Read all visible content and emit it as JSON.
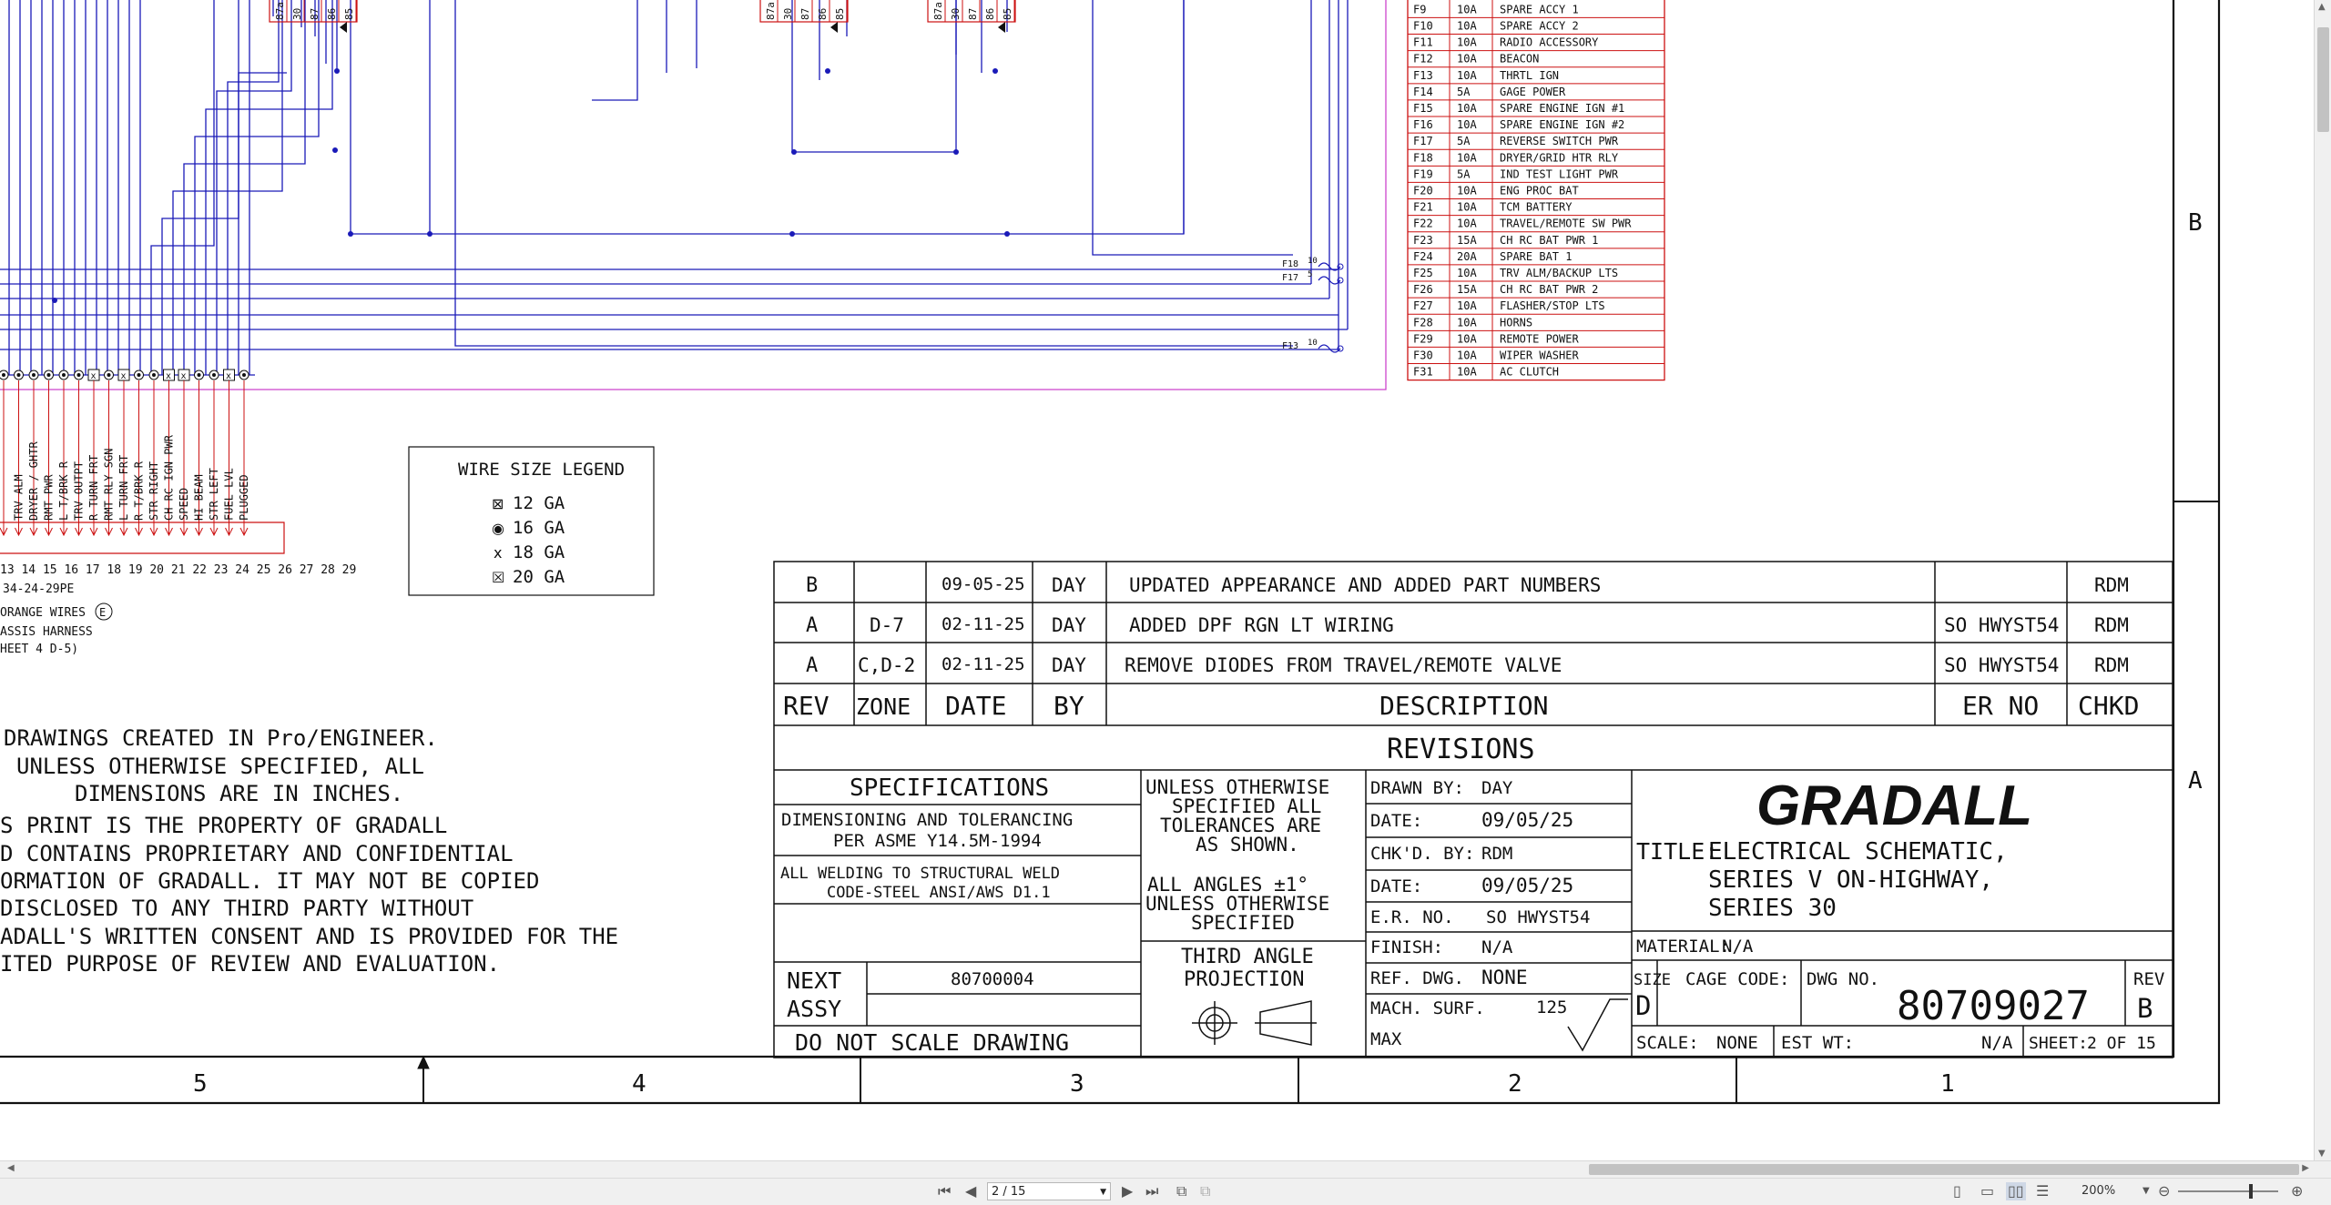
{
  "drawing": {
    "fuse_table": [
      [
        "F9",
        "10A",
        "SPARE ACCY 1"
      ],
      [
        "F10",
        "10A",
        "SPARE ACCY 2"
      ],
      [
        "F11",
        "10A",
        "RADIO ACCESSORY"
      ],
      [
        "F12",
        "10A",
        "BEACON"
      ],
      [
        "F13",
        "10A",
        "THRTL IGN"
      ],
      [
        "F14",
        "5A",
        "GAGE POWER"
      ],
      [
        "F15",
        "10A",
        "SPARE ENGINE IGN #1"
      ],
      [
        "F16",
        "10A",
        "SPARE ENGINE IGN #2"
      ],
      [
        "F17",
        "5A",
        "REVERSE SWITCH PWR"
      ],
      [
        "F18",
        "10A",
        "DRYER/GRID HTR RLY"
      ],
      [
        "F19",
        "5A",
        "IND TEST LIGHT PWR"
      ],
      [
        "F20",
        "10A",
        "ENG PROC BAT"
      ],
      [
        "F21",
        "10A",
        "TCM BATTERY"
      ],
      [
        "F22",
        "10A",
        "TRAVEL/REMOTE SW PWR"
      ],
      [
        "F23",
        "15A",
        "CH RC BAT PWR 1"
      ],
      [
        "F24",
        "20A",
        "SPARE BAT 1"
      ],
      [
        "F25",
        "10A",
        "TRV ALM/BACKUP LTS"
      ],
      [
        "F26",
        "15A",
        "CH RC BAT PWR 2"
      ],
      [
        "F27",
        "10A",
        "FLASHER/STOP LTS"
      ],
      [
        "F28",
        "10A",
        "HORNS"
      ],
      [
        "F29",
        "10A",
        "REMOTE POWER"
      ],
      [
        "F30",
        "10A",
        "WIPER WASHER"
      ],
      [
        "F31",
        "10A",
        "AC CLUTCH"
      ]
    ],
    "relay1_pins": [
      "87a",
      "30",
      "87",
      "86",
      "85"
    ],
    "relay2_pins": [
      "87a",
      "30",
      "87",
      "86",
      "85"
    ],
    "relay3_pins": [
      "87a",
      "30",
      "87",
      "86",
      "85"
    ],
    "fuse_taps": [
      {
        "id": "F18",
        "amp": "10"
      },
      {
        "id": "F17",
        "amp": "5"
      },
      {
        "id": "F13",
        "amp": "10"
      }
    ],
    "terminal_labels": [
      "",
      "TRV ALM",
      "DRYER / GHTR",
      "RMT PWR",
      "L T/BRK R",
      "TRV OUTPT",
      "R TURN FRT",
      "RMT RLY SGN",
      "L TURN FRT",
      "R T/BRK R",
      "STR RIGHT",
      "CH RC IGN PWR",
      "SPEED",
      "HI BEAM",
      "STR LEFT",
      "FUEL LVL",
      "PLUGGED"
    ],
    "terminal_markers": [
      "dot",
      "dot",
      "dot",
      "dot",
      "dot",
      "dot",
      "box",
      "dot",
      "box",
      "dot",
      "dot",
      "box",
      "box",
      "dot",
      "dot",
      "box",
      "dot"
    ],
    "terminal_numbers": "13 14 15 16 17 18 19 20 21 22 23 24 25 26 27 28 29",
    "connector_part": "34-24-29PE",
    "connector_notes": [
      "ORANGE WIRES",
      "ASSIS HARNESS",
      "HEET 4 D-5)"
    ],
    "connector_badge": "E",
    "wire_legend": {
      "title": "WIRE SIZE LEGEND",
      "items": [
        {
          "symbol": "⊠",
          "label": "12 GA"
        },
        {
          "symbol": "◉",
          "label": "16 GA"
        },
        {
          "symbol": "x",
          "label": "18 GA"
        },
        {
          "symbol": "☒",
          "label": "20 GA"
        }
      ]
    },
    "notes": [
      "DRAWINGS CREATED IN Pro/ENGINEER.",
      "UNLESS OTHERWISE SPECIFIED, ALL",
      "DIMENSIONS ARE IN INCHES.",
      "S PRINT IS THE PROPERTY OF GRADALL",
      "D CONTAINS PROPRIETARY AND CONFIDENTIAL",
      "ORMATION OF GRADALL. IT MAY NOT BE COPIED",
      "DISCLOSED TO ANY THIRD PARTY WITHOUT",
      "ADALL'S WRITTEN CONSENT AND IS PROVIDED FOR THE",
      "ITED PURPOSE OF REVIEW AND EVALUATION."
    ],
    "revisions": [
      {
        "rev": "B",
        "zone": "",
        "date": "09-05-25",
        "by": "DAY",
        "desc": "UPDATED APPEARANCE AND ADDED PART NUMBERS",
        "er": "",
        "chkd": "RDM"
      },
      {
        "rev": "A",
        "zone": "D-7",
        "date": "02-11-25",
        "by": "DAY",
        "desc": "ADDED DPF RGN LT WIRING",
        "er": "SO HWYST54",
        "chkd": "RDM"
      },
      {
        "rev": "A",
        "zone": "C,D-2",
        "date": "02-11-25",
        "by": "DAY",
        "desc": "REMOVE DIODES FROM TRAVEL/REMOTE VALVE",
        "er": "SO HWYST54",
        "chkd": "RDM"
      }
    ],
    "rev_headers": [
      "REV",
      "ZONE",
      "DATE",
      "BY",
      "DESCRIPTION",
      "ER NO",
      "CHKD"
    ],
    "revisions_title": "REVISIONS",
    "spec_title": "SPECIFICATIONS",
    "spec_lines": [
      "DIMENSIONING AND TOLERANCING",
      "PER ASME Y14.5M-1994",
      "ALL WELDING TO STRUCTURAL WELD",
      "CODE-STEEL ANSI/AWS D1.1"
    ],
    "next_assy_label": [
      "NEXT",
      "ASSY"
    ],
    "next_assy": "80700004",
    "do_not_scale": "DO NOT SCALE DRAWING",
    "tolerance_lines": [
      "UNLESS OTHERWISE",
      "SPECIFIED ALL",
      "TOLERANCES ARE",
      "AS SHOWN."
    ],
    "angle_lines": [
      "ALL ANGLES ±1°",
      "UNLESS OTHERWISE",
      "SPECIFIED"
    ],
    "projection_lines": [
      "THIRD ANGLE",
      "PROJECTION"
    ],
    "drawn_by_label": "DRAWN BY:",
    "drawn_by": "DAY",
    "date_label": "DATE:",
    "date1": "09/05/25",
    "chkd_by_label": "CHK'D. BY:",
    "chkd_by": "RDM",
    "date2": "09/05/25",
    "er_no_label": "E.R. NO.",
    "er_no": "SO HWYST54",
    "finish_label": "FINISH:",
    "finish": "N/A",
    "ref_dwg_label": "REF. DWG.",
    "ref_dwg": "NONE",
    "mach_surf_label": "MACH. SURF.",
    "mach_surf": "125",
    "max_label": "MAX",
    "company": "GRADALL",
    "title_label": "TITLE:",
    "title_lines": [
      "ELECTRICAL SCHEMATIC,",
      "SERIES V ON-HIGHWAY,",
      "SERIES 30"
    ],
    "material_label": "MATERIAL:",
    "material": "N/A",
    "size_label": "SIZE",
    "size": "D",
    "cage_label": "CAGE CODE:",
    "dwg_no_label": "DWG NO.",
    "dwg_no": "80709027",
    "rev_label": "REV",
    "rev": "B",
    "scale_label": "SCALE:",
    "scale": "NONE",
    "est_wt_label": "EST WT:",
    "est_wt": "N/A",
    "sheet_label": "SHEET:",
    "sheet": "2 OF 15",
    "zone_columns": [
      "5",
      "4",
      "3",
      "2",
      "1"
    ],
    "zone_rows": [
      "B",
      "A"
    ]
  },
  "viewer": {
    "page_field": "2 / 15",
    "zoom": "200%",
    "nav_first": "⏮",
    "nav_prev": "◀",
    "nav_next": "▶",
    "nav_last": "⏭"
  },
  "colors": {
    "wire": "#1a1ab8",
    "relay": "#cc1111",
    "fuse_table": "#cc1111",
    "boundary": "#cc44cc",
    "ink": "#111111"
  }
}
